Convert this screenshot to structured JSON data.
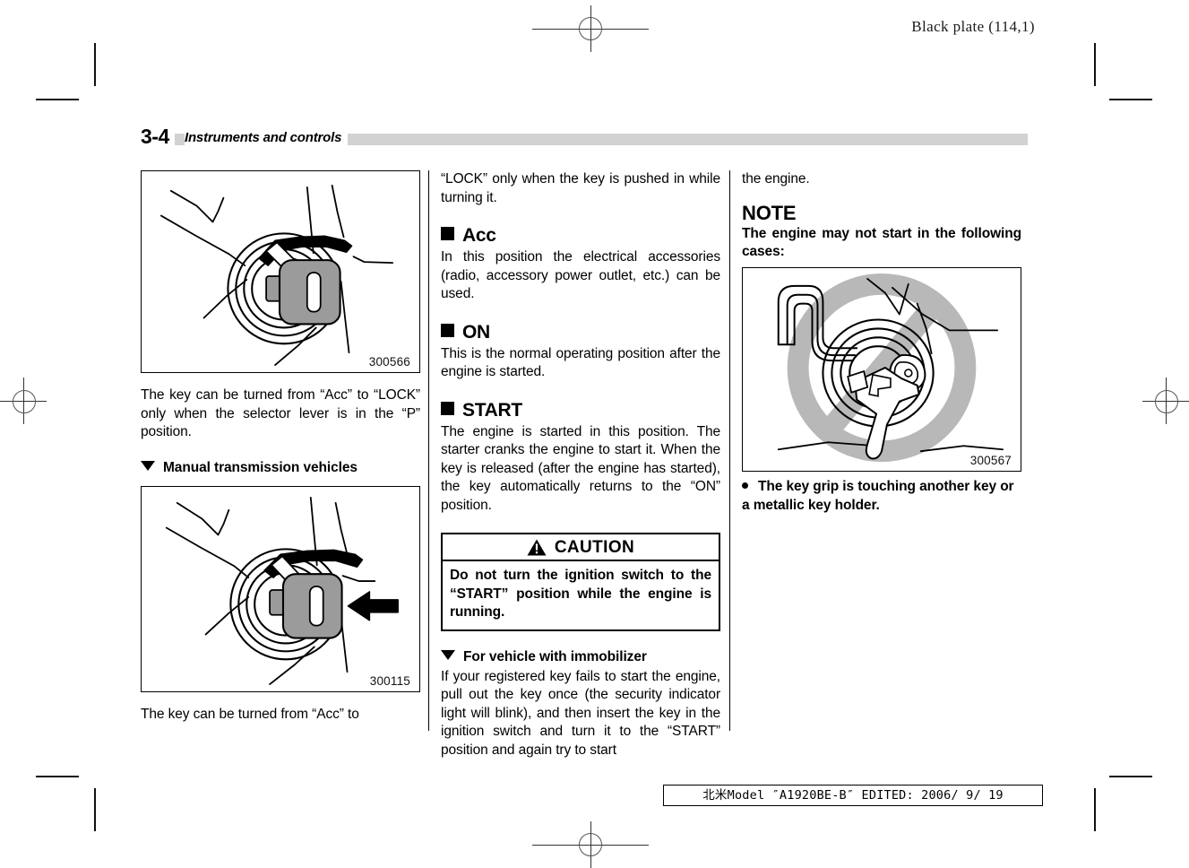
{
  "print_marks": {
    "black_plate": "Black plate (114,1)"
  },
  "header": {
    "page_number": "3-4",
    "chapter_title": "Instruments and controls"
  },
  "columns": {
    "left": {
      "figure_1": {
        "id": "300566",
        "caption_icon": "ignition-switch-key-illustration"
      },
      "paragraph_1": "The key can be turned from “Acc” to “LOCK” only when the selector lever is in the “P” position.",
      "subheading_1": "Manual transmission vehicles",
      "figure_2": {
        "id": "300115",
        "caption_icon": "ignition-switch-key-push-illustration"
      },
      "paragraph_2": "The key can be turned from “Acc” to"
    },
    "middle": {
      "paragraph_1": "“LOCK” only when the key is pushed in while turning it.",
      "section_acc": {
        "title": "Acc",
        "body": "In this position the electrical accessories (radio, accessory power outlet, etc.) can be used."
      },
      "section_on": {
        "title": "ON",
        "body": "This is the normal operating position after the engine is started."
      },
      "section_start": {
        "title": "START",
        "body": "The engine is started in this position. The starter cranks the engine to start it. When the key is released (after the engine has started), the key automatically returns to the “ON” position."
      },
      "caution": {
        "label": "CAUTION",
        "body": "Do not turn the ignition switch to the “START” position while the engine is running."
      },
      "subheading_immobilizer": "For vehicle with immobilizer",
      "paragraph_immobilizer": "If your registered key fails to start the engine, pull out the key once (the security indicator light will blink), and then insert the key in the ignition switch and turn it to the “START” position and again try to start"
    },
    "right": {
      "paragraph_1": "the engine.",
      "note_title": "NOTE",
      "note_body": "The engine may not start in the following cases:",
      "figure_3": {
        "id": "300567",
        "caption_icon": "key-prohibited-illustration"
      },
      "bullets": [
        "The key grip is touching another key or a metallic key holder."
      ]
    }
  },
  "footer": {
    "text": "北米Model ″A1920BE-B″ EDITED: 2006/ 9/ 19"
  },
  "colors": {
    "header_rule": "#d2d2d2",
    "key_gray": "#9b9b9b",
    "prohibit_gray": "#b8b8b8",
    "ink": "#000000"
  }
}
